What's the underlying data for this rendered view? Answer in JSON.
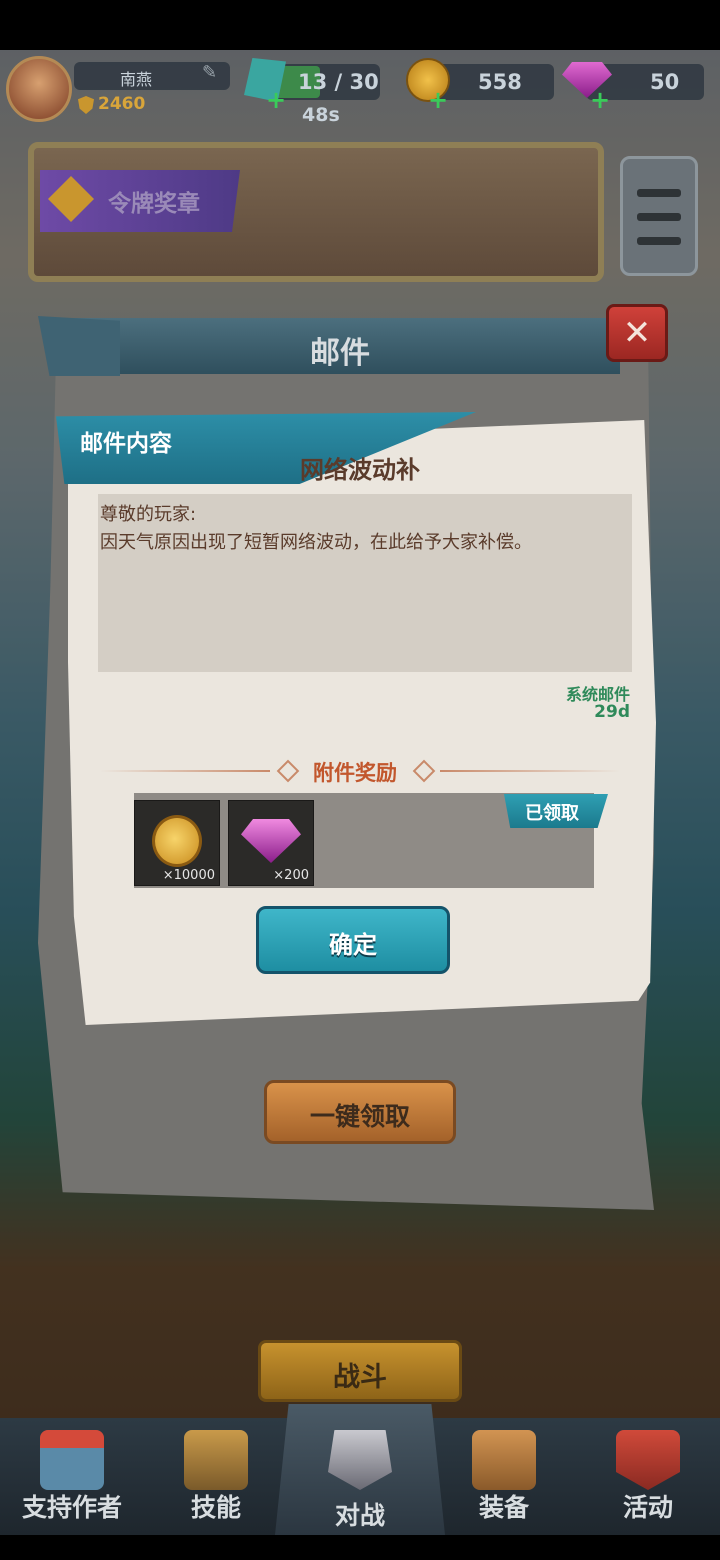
{
  "player": {
    "name": "南燕",
    "power": "2460"
  },
  "resources": {
    "energy": "13 / 30",
    "energy_timer": "48s",
    "coins": "558",
    "gems": "50"
  },
  "banner": {
    "tag_label": "令牌奖章"
  },
  "mail_panel": {
    "title": "邮件",
    "claim_all_label": "一键领取"
  },
  "mail_detail": {
    "tab_label": "邮件内容",
    "subject": "网络波动补",
    "greeting": "尊敬的玩家:",
    "body": "因天气原因出现了短暂网络波动，在此给予大家补偿。",
    "sender_type": "系统邮件",
    "expiry": "29d",
    "attachments_label": "附件奖励",
    "claimed_label": "已领取",
    "rewards": [
      {
        "icon": "coin-icon",
        "qty": "×10000"
      },
      {
        "icon": "gem-icon",
        "qty": "×200"
      }
    ],
    "confirm_label": "确定"
  },
  "battle_button_label": "战斗",
  "bottom_nav": [
    {
      "label": "支持作者",
      "icon": "shop-icon"
    },
    {
      "label": "技能",
      "icon": "skill-icon"
    },
    {
      "label": "对战",
      "icon": "battle-icon"
    },
    {
      "label": "装备",
      "icon": "backpack-icon"
    },
    {
      "label": "活动",
      "icon": "event-icon"
    }
  ],
  "colors": {
    "accent_teal": "#1e8ea2",
    "claim_orange": "#c98a5a",
    "close_red": "#c0392b",
    "attachment_label": "#c2572d",
    "system_mail_green": "#2f8a5a"
  }
}
